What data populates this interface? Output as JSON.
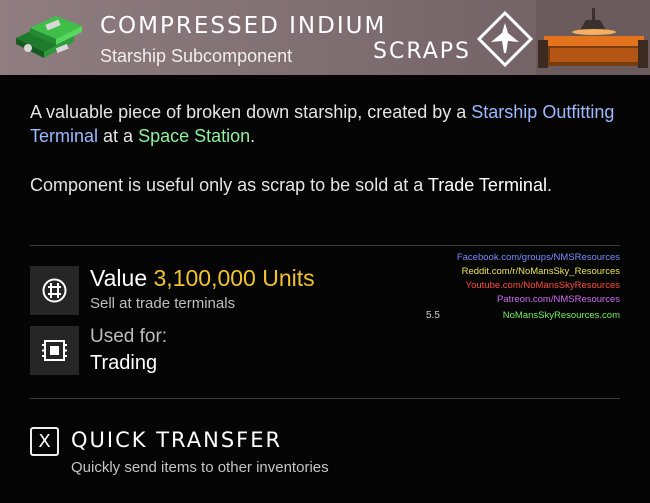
{
  "header": {
    "title": "COMPRESSED INDIUM",
    "subtitle": "Starship Subcomponent",
    "category_label": "SCRAPS",
    "item_icon": "compressed-indium-icon",
    "category_icon": "starship-diamond-icon",
    "terminal_image": "outfitting-terminal-image"
  },
  "description": {
    "p1_a": "A valuable piece of broken down starship, created by a ",
    "p1_link1": "Starship Outfitting Terminal",
    "p1_b": " at a ",
    "p1_link2": "Space Station",
    "p1_c": ".",
    "p2_a": "Component is useful only as scrap to be sold at a ",
    "p2_link": "Trade Terminal",
    "p2_b": "."
  },
  "stats": {
    "value_label": "Value",
    "value_amount": "3,100,000 Units",
    "value_sub": "Sell at trade terminals",
    "value_icon": "units-currency-icon",
    "used_for_label": "Used for:",
    "used_for_value": "Trading",
    "used_for_icon": "chip-icon"
  },
  "watermark": {
    "lines": [
      "Facebook.com/groups/NMSResources",
      "Reddit.com/r/NoMansSky_Resources",
      "Youtube.com/NoMansSkyResources",
      "Patreon.com/NMSResources",
      "NoMansSkyResources.com"
    ],
    "version": "5.5"
  },
  "action": {
    "key": "X",
    "title": "QUICK TRANSFER",
    "description": "Quickly send items to other inventories"
  },
  "colors": {
    "header_bg": "#8f7d80",
    "value_gold": "#f0c32e",
    "link_blue": "#9cb8ff",
    "link_green": "#8ff09e"
  }
}
